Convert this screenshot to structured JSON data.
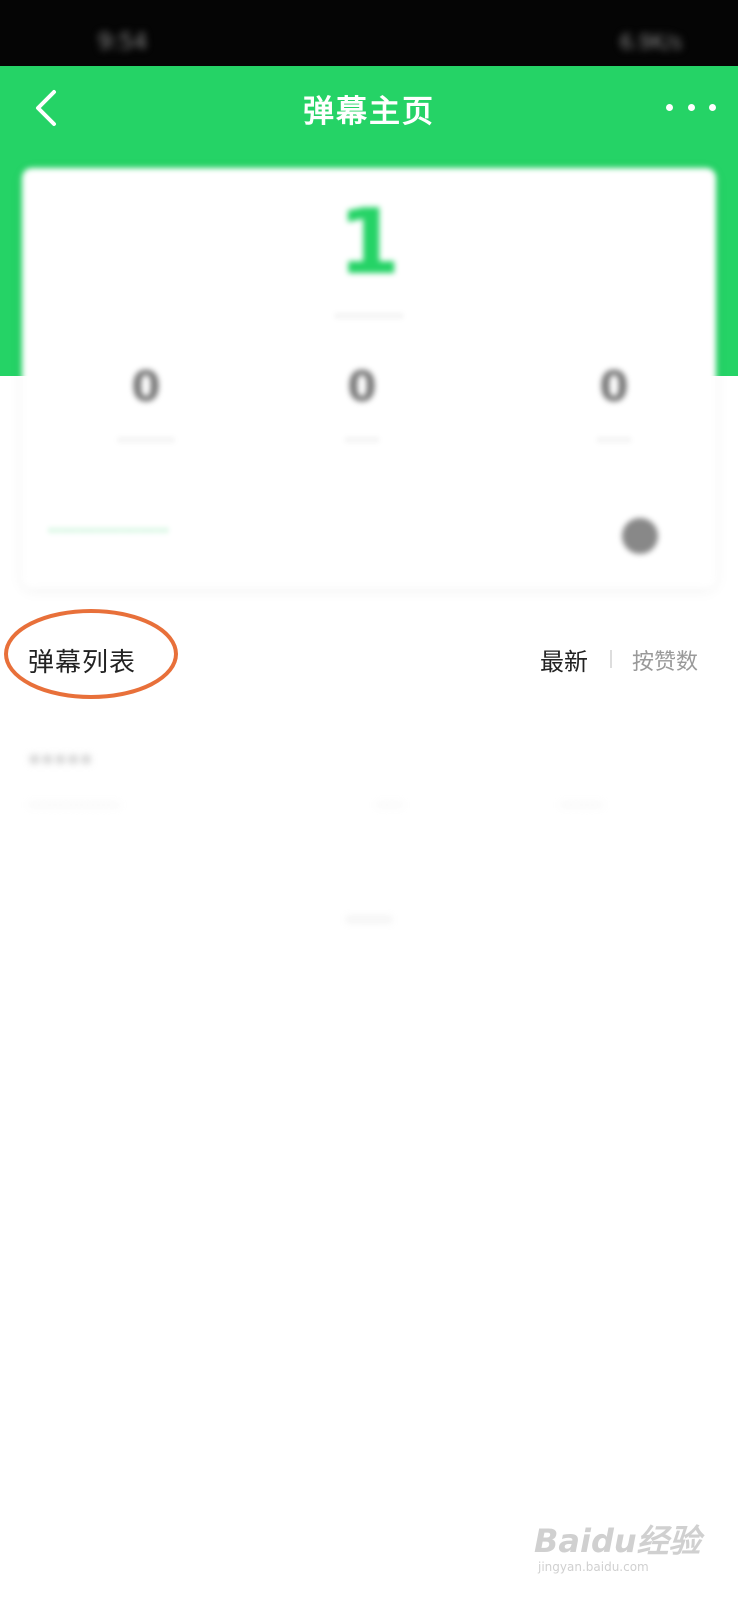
{
  "status_bar": {
    "time": "9:54",
    "right_indicators": "6.9K/s"
  },
  "header": {
    "title": "弹幕主页",
    "back_icon": "chevron-left-icon",
    "more_icon": "more-icon"
  },
  "stats": {
    "total_value": "1",
    "item_1": "0",
    "item_2": "0",
    "item_3": "0"
  },
  "section": {
    "title": "弹幕列表",
    "sort_newest": "最新",
    "sort_likes": "按赞数",
    "highlight_color": "#E8703A"
  },
  "colors": {
    "accent": "#25D366"
  },
  "watermark": {
    "logo": "Baidu经验",
    "sub": "jingyan.baidu.com"
  }
}
